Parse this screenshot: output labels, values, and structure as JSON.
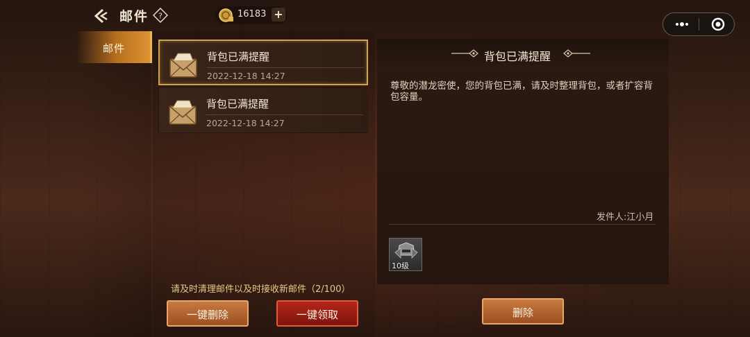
{
  "header": {
    "title": "邮件",
    "currency": {
      "value": "16183",
      "add_label": "+"
    }
  },
  "tabs": [
    {
      "label": "邮件",
      "active": true
    }
  ],
  "mail_list": {
    "items": [
      {
        "title": "背包已满提醒",
        "date": "2022-12-18 14:27",
        "selected": true
      },
      {
        "title": "背包已满提醒",
        "date": "2022-12-18 14:27",
        "selected": false
      }
    ],
    "notice": "请及时清理邮件以及时接收新邮件（2/100）",
    "delete_all_label": "一键删除",
    "claim_all_label": "一键领取"
  },
  "detail": {
    "title": "背包已满提醒",
    "body": "尊敬的潜龙密使，您的背包已满，请及时整理背包，或者扩容背包容量。",
    "sender": "发件人:江小月",
    "attachment": {
      "label": "10级"
    },
    "delete_label": "删除"
  },
  "colors": {
    "accent_gold": "#cfa54b",
    "tab_active": "#dc9331",
    "button_orange": "#c77a3f",
    "button_red": "#b5261a"
  },
  "icons": [
    "back-arrow-icon",
    "help-icon",
    "coin-icon",
    "more-icon",
    "close-icon",
    "envelope-icon",
    "helmet-icon"
  ]
}
